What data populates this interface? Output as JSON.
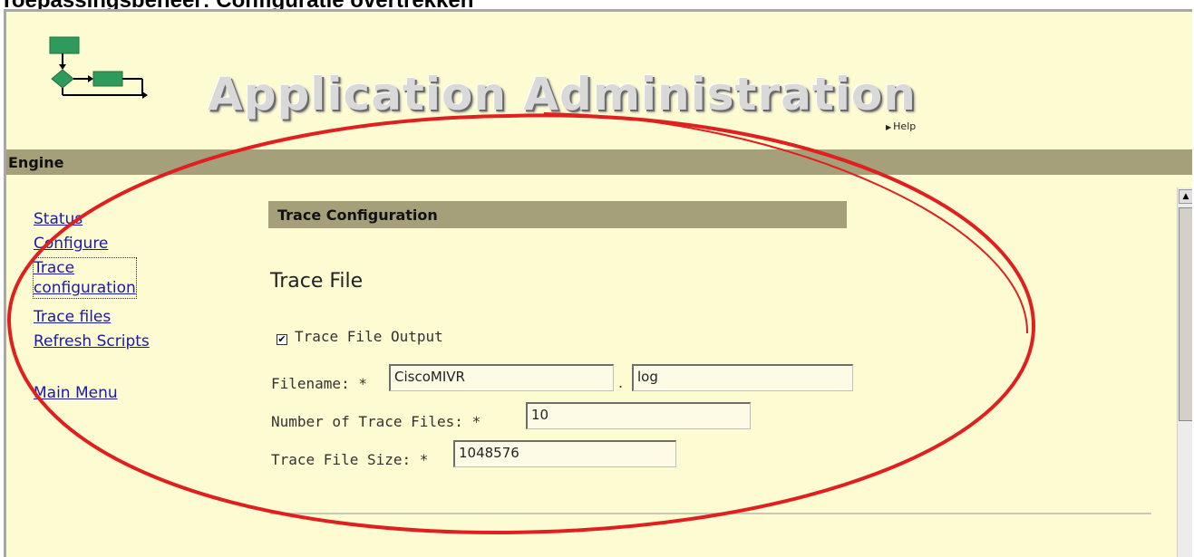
{
  "caption": "Toepassingsbeheer: Configuratie overtrekken",
  "header": {
    "app_title": "Application Administration",
    "help_label": "Help"
  },
  "engine_bar": {
    "label": "Engine"
  },
  "nav": {
    "items": [
      {
        "label": "Status"
      },
      {
        "label": "Configure"
      },
      {
        "label": "Trace",
        "label2": "configuration"
      },
      {
        "label": "Trace files"
      },
      {
        "label": "Refresh Scripts"
      },
      {
        "label": "Main Menu"
      }
    ]
  },
  "main": {
    "section_title": "Trace Configuration",
    "subsection_title": "Trace File",
    "trace_output": {
      "label": "Trace File Output",
      "checked": true
    },
    "filename": {
      "label": "Filename:",
      "required": "*",
      "value": "CiscoMIVR",
      "separator": ".",
      "extension": "log"
    },
    "num_files": {
      "label": "Number of Trace Files:",
      "required": "*",
      "value": "10"
    },
    "file_size": {
      "label": "Trace File Size:",
      "required": "*",
      "value": "1048576"
    }
  },
  "colors": {
    "background": "#fdfbd1",
    "bar": "#a6a07a",
    "link": "#1a1aa8",
    "annotation": "#e02020",
    "logo_green": "#2e9b5c"
  },
  "icons": {
    "logo": "workflow-logo-icon",
    "annotation": "red-ellipse-annotation"
  }
}
